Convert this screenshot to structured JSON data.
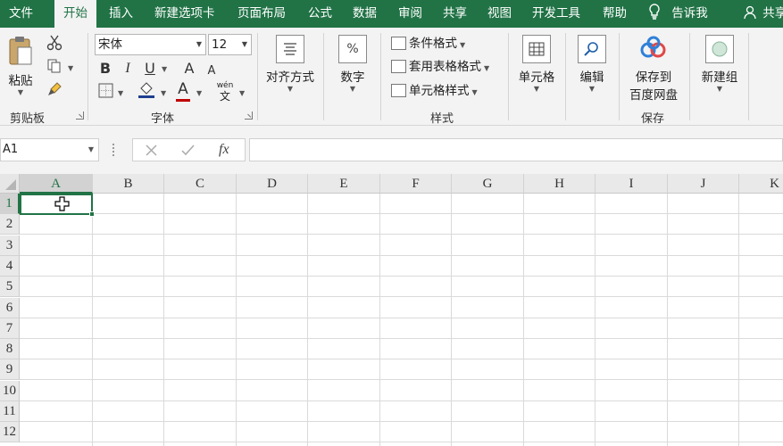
{
  "menu": {
    "tabs": [
      "文件",
      "开始",
      "插入",
      "新建选项卡",
      "页面布局",
      "公式",
      "数据",
      "审阅",
      "共享",
      "视图",
      "开发工具",
      "帮助"
    ],
    "active_tab": "开始",
    "tell_me": "告诉我",
    "share": "共享"
  },
  "ribbon": {
    "clipboard": {
      "paste_label": "粘贴",
      "group_label": "剪贴板"
    },
    "font": {
      "name": "宋体",
      "size": "12",
      "bold": "B",
      "italic": "I",
      "underline": "U",
      "grow": "A",
      "shrink": "A",
      "font_color": "A",
      "phonetic_top": "wén",
      "phonetic_bottom": "文",
      "group_label": "字体"
    },
    "alignment": {
      "label": "对齐方式"
    },
    "number": {
      "label": "数字",
      "icon_text": "%"
    },
    "styles": {
      "conditional": "条件格式",
      "table": "套用表格格式",
      "cell": "单元格样式",
      "group_label": "样式"
    },
    "cells": {
      "label": "单元格"
    },
    "editing": {
      "label": "编辑"
    },
    "save": {
      "line1": "保存到",
      "line2": "百度网盘",
      "group_label": "保存"
    },
    "newgroup": {
      "label": "新建组"
    }
  },
  "formula_bar": {
    "name_box": "A1",
    "fx": "fx",
    "value": ""
  },
  "sheet": {
    "columns": [
      "A",
      "B",
      "C",
      "D",
      "E",
      "F",
      "G",
      "H",
      "I",
      "J",
      "K"
    ],
    "rows": [
      "1",
      "2",
      "3",
      "4",
      "5",
      "6",
      "7",
      "8",
      "9",
      "10",
      "11",
      "12"
    ],
    "selected_cell": "A1"
  },
  "colors": {
    "accent": "#217346",
    "ribbon_bg": "#f3f3f3"
  }
}
